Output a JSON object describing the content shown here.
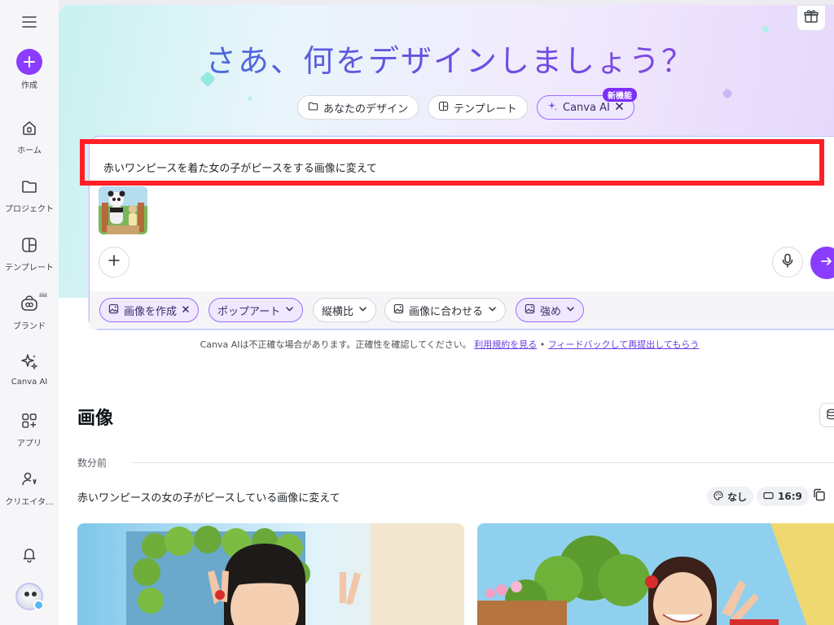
{
  "sidebar": {
    "items": [
      {
        "label": "作成"
      },
      {
        "label": "ホーム"
      },
      {
        "label": "プロジェクト"
      },
      {
        "label": "テンプレート"
      },
      {
        "label": "ブランド"
      },
      {
        "label": "Canva AI"
      },
      {
        "label": "アプリ"
      },
      {
        "label": "クリエイタ..."
      }
    ]
  },
  "hero": {
    "title": "さあ、何をデザインしましょう？"
  },
  "tabs": [
    {
      "label": "あなたのデザイン"
    },
    {
      "label": "テンプレート"
    },
    {
      "label": "Canva AI",
      "badge": "新機能"
    }
  ],
  "prompt": {
    "text": "赤いワンピースを着た女の子がピースをする画像に変えて"
  },
  "options": [
    {
      "label": "画像を作成"
    },
    {
      "label": "ポップアート"
    },
    {
      "label": "縦横比"
    },
    {
      "label": "画像に合わせる"
    },
    {
      "label": "強め"
    }
  ],
  "disclaimer": {
    "text": "Canva AIは不正確な場合があります。正確性を確認してください。",
    "link1": "利用規約を見る",
    "separator": "•",
    "link2": "フィードバックして再提出してもらう"
  },
  "results": {
    "section_title": "画像",
    "time_label": "数分前",
    "prompt": "赤いワンピースの女の子がピースしている画像に変えて",
    "meta": [
      {
        "label": "なし"
      },
      {
        "label": "16:9"
      }
    ]
  },
  "colors": {
    "accent": "#8b3dff",
    "highlight": "#ff1f26"
  }
}
